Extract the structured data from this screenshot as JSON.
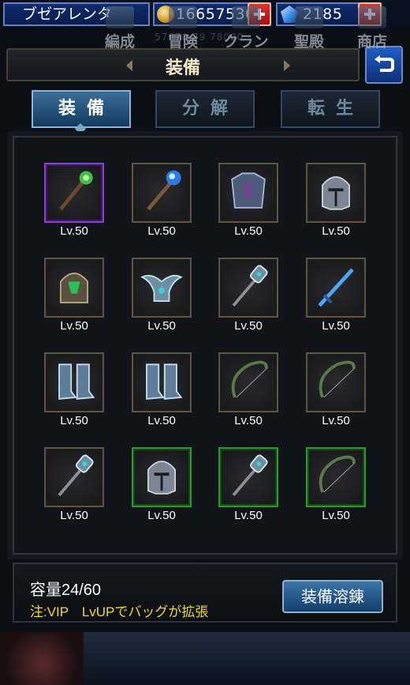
{
  "topbar": {
    "player_name": "ブゼアレンタ",
    "gold": "16657530",
    "gems": "2185"
  },
  "bg_digits": "57670 79 78000",
  "header": {
    "title": "装備"
  },
  "tabs": [
    {
      "label": "装備",
      "active": true
    },
    {
      "label": "分解",
      "active": false
    },
    {
      "label": "転生",
      "active": false
    }
  ],
  "inventory": {
    "items": [
      {
        "icon": "nature-staff-icon",
        "level": "Lv.50",
        "rarity": "purple"
      },
      {
        "icon": "crystal-staff-icon",
        "level": "Lv.50",
        "rarity": "normal"
      },
      {
        "icon": "chest-armor-icon",
        "level": "Lv.50",
        "rarity": "normal"
      },
      {
        "icon": "knight-helmet-icon",
        "level": "Lv.50",
        "rarity": "normal"
      },
      {
        "icon": "green-helmet-icon",
        "level": "Lv.50",
        "rarity": "normal"
      },
      {
        "icon": "winged-helmet-icon",
        "level": "Lv.50",
        "rarity": "normal"
      },
      {
        "icon": "mace-icon",
        "level": "Lv.50",
        "rarity": "normal"
      },
      {
        "icon": "blue-sword-icon",
        "level": "Lv.50",
        "rarity": "normal"
      },
      {
        "icon": "greaves-icon",
        "level": "Lv.50",
        "rarity": "normal"
      },
      {
        "icon": "greaves-icon",
        "level": "Lv.50",
        "rarity": "normal"
      },
      {
        "icon": "bow-icon",
        "level": "Lv.50",
        "rarity": "normal"
      },
      {
        "icon": "bow-icon",
        "level": "Lv.50",
        "rarity": "normal"
      },
      {
        "icon": "mace-icon",
        "level": "Lv.50",
        "rarity": "normal"
      },
      {
        "icon": "knight-helmet-icon",
        "level": "Lv.50",
        "rarity": "green"
      },
      {
        "icon": "mace-icon",
        "level": "Lv.50",
        "rarity": "green"
      },
      {
        "icon": "bow-icon",
        "level": "Lv.50",
        "rarity": "green"
      }
    ]
  },
  "footer": {
    "capacity": "容量24/60",
    "note": "注:VIP　LvUPでバッグが拡張",
    "smelt_label": "装備溶錬"
  },
  "nav": [
    {
      "label": "編成",
      "icon": "formation-icon"
    },
    {
      "label": "冒険",
      "icon": "adventure-icon"
    },
    {
      "label": "クラン",
      "icon": "clan-icon"
    },
    {
      "label": "聖殿",
      "icon": "temple-icon"
    },
    {
      "label": "商店",
      "icon": "shop-icon"
    }
  ],
  "colors": {
    "accent": "#1f5ec4",
    "note": "#f2d82a",
    "rarity_purple": "#8a3fd0",
    "rarity_green": "#2b9b2b"
  }
}
